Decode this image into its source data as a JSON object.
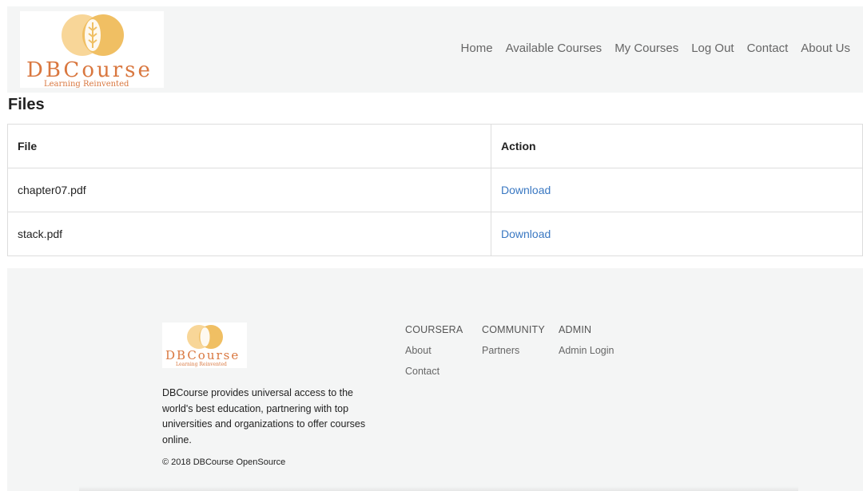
{
  "brand": {
    "name": "DBCourse",
    "tagline": "Learning Reinvented"
  },
  "nav": {
    "items": [
      "Home",
      "Available Courses",
      "My Courses",
      "Log Out",
      "Contact",
      "About Us"
    ]
  },
  "page": {
    "title": "Files"
  },
  "table": {
    "headers": [
      "File",
      "Action"
    ],
    "rows": [
      {
        "file": "chapter07.pdf",
        "action": "Download"
      },
      {
        "file": "stack.pdf",
        "action": "Download"
      }
    ]
  },
  "footer": {
    "description": "DBCourse provides universal access to the world's best education, partnering with top universities and organizations to offer courses online.",
    "copyright": "© 2018 DBCourse OpenSource",
    "columns": [
      {
        "heading": "COURSERA",
        "links": [
          "About",
          "Contact"
        ]
      },
      {
        "heading": "COMMUNITY",
        "links": [
          "Partners"
        ]
      },
      {
        "heading": "ADMIN",
        "links": [
          "Admin Login"
        ]
      }
    ]
  },
  "colors": {
    "logo_gold": "#f0bf63",
    "logo_text": "#d9773f",
    "link_blue": "#3a78c2",
    "header_bg": "#f4f5f5"
  }
}
